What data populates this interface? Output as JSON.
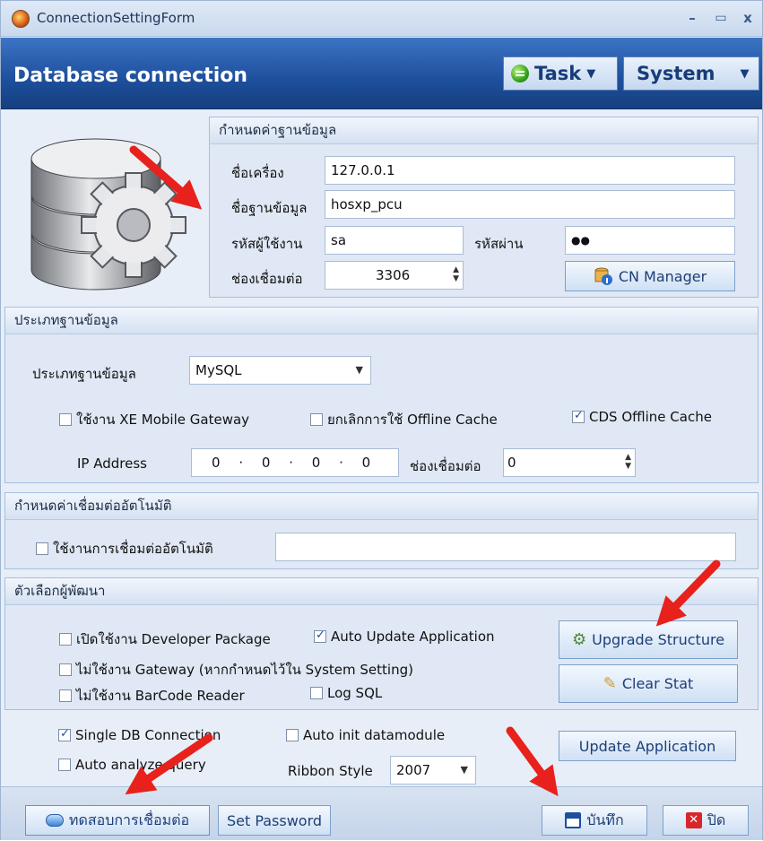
{
  "window": {
    "title": "ConnectionSettingForm",
    "minimize": "–",
    "maximize": "▭",
    "close": "x"
  },
  "header": {
    "title": "Database connection",
    "task_label": "Task",
    "system_label": "System"
  },
  "db_group": {
    "title": "กำหนดค่าฐานข้อมูล",
    "host_label": "ชื่อเครื่อง",
    "host_value": "127.0.0.1",
    "dbname_label": "ชื่อฐานข้อมูล",
    "dbname_value": "hosxp_pcu",
    "user_label": "รหัสผู้ใช้งาน",
    "user_value": "sa",
    "password_label": "รหัสผ่าน",
    "password_value": "●●",
    "port_label": "ช่องเชื่อมต่อ",
    "port_value": "3306",
    "cn_manager_label": "CN Manager"
  },
  "dbtype_group": {
    "title": "ประเภทฐานข้อมูล",
    "type_label": "ประเภทฐานข้อมูล",
    "type_value": "MySQL",
    "xe_gateway_label": "ใช้งาน XE Mobile Gateway",
    "xe_gateway_checked": false,
    "offline_cache_label": "ยกเลิกการใช้ Offline Cache",
    "offline_cache_checked": false,
    "cds_cache_label": "CDS Offline Cache",
    "cds_cache_checked": true,
    "ip_label": "IP Address",
    "ip_values": [
      "0",
      "0",
      "0",
      "0"
    ],
    "ip_port_label": "ช่องเชื่อมต่อ",
    "ip_port_value": "0"
  },
  "auto_group": {
    "title": "กำหนดค่าเชื่อมต่ออัตโนมัติ",
    "auto_label": "ใช้งานการเชื่อมต่ออัตโนมัติ",
    "auto_checked": false,
    "auto_value": ""
  },
  "dev_group": {
    "title": "ตัวเลือกผู้พัฒนา",
    "dev_package_label": "เปิดใช้งาน Developer Package",
    "auto_update_label": "Auto Update Application",
    "no_gateway_label": "ไม่ใช้งาน Gateway (หากกำหนดไว้ใน System Setting)",
    "no_barcode_label": "ไม่ใช้งาน BarCode Reader",
    "log_sql_label": "Log SQL",
    "upgrade_label": "Upgrade Structure",
    "clear_stat_label": "Clear Stat"
  },
  "misc": {
    "single_db_label": "Single DB Connection",
    "auto_init_label": "Auto init datamodule",
    "auto_analyze_label": "Auto analyze query",
    "ribbon_label": "Ribbon Style",
    "ribbon_value": "2007",
    "update_app_label": "Update Application"
  },
  "footer": {
    "test_label": "ทดสอบการเชื่อมต่อ",
    "set_password_label": "Set Password",
    "save_label": "บันทึก",
    "close_label": "ปิด"
  },
  "colors": {
    "header": "#1d4f9c",
    "annotation_arrow": "#e8211c",
    "panel": "#dfe8f4"
  }
}
